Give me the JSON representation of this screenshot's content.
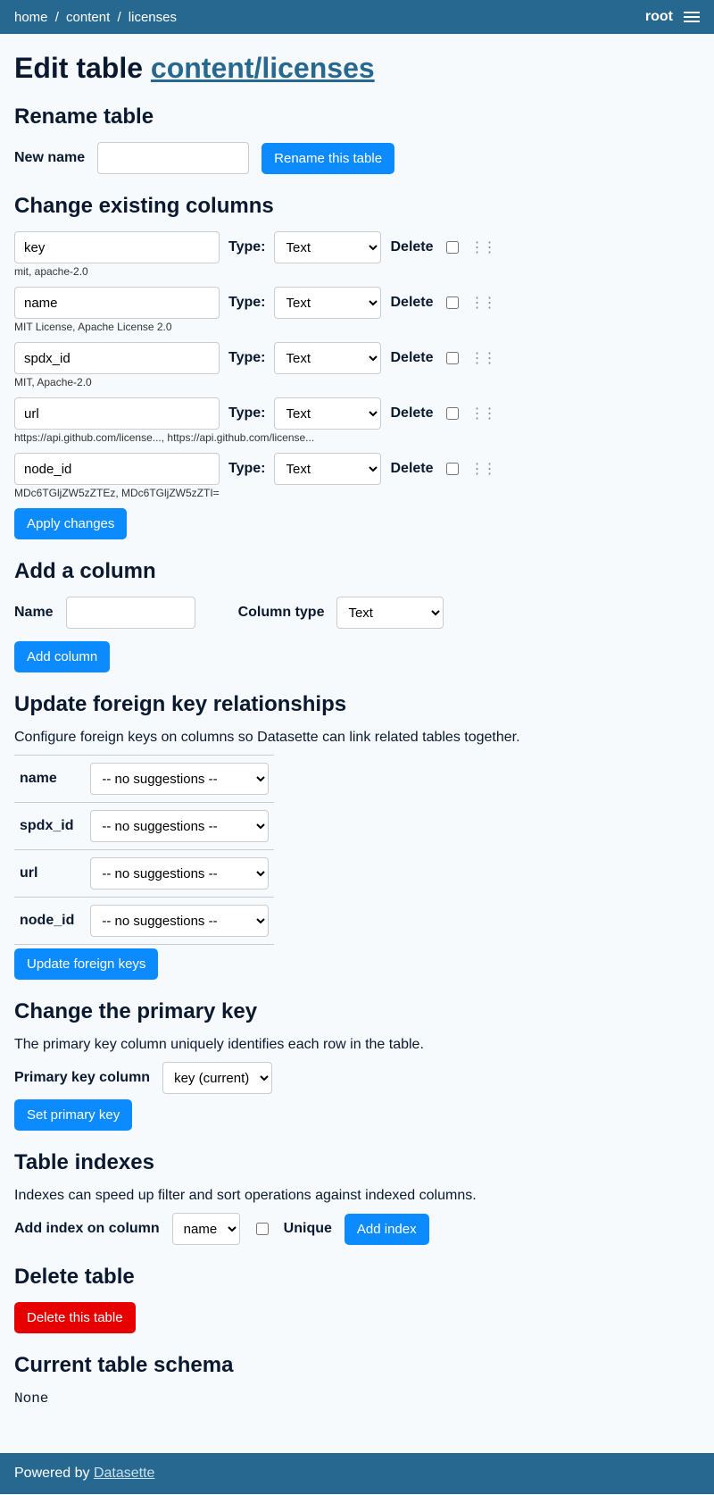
{
  "breadcrumb": {
    "home": "home",
    "content": "content",
    "licenses": "licenses"
  },
  "header": {
    "user": "root"
  },
  "page_title_prefix": "Edit table ",
  "page_title_link": "content/licenses",
  "rename": {
    "heading": "Rename table",
    "label": "New name",
    "button": "Rename this table"
  },
  "columns": {
    "heading": "Change existing columns",
    "type_label": "Type:",
    "delete_label": "Delete",
    "apply_button": "Apply changes",
    "type_options": [
      "Text"
    ],
    "items": [
      {
        "name": "key",
        "type": "Text",
        "sample": "mit, apache-2.0"
      },
      {
        "name": "name",
        "type": "Text",
        "sample": "MIT License, Apache License 2.0"
      },
      {
        "name": "spdx_id",
        "type": "Text",
        "sample": "MIT, Apache-2.0"
      },
      {
        "name": "url",
        "type": "Text",
        "sample": "https://api.github.com/license..., https://api.github.com/license..."
      },
      {
        "name": "node_id",
        "type": "Text",
        "sample": "MDc6TGljZW5zZTEz, MDc6TGljZW5zZTI="
      }
    ]
  },
  "add_column": {
    "heading": "Add a column",
    "name_label": "Name",
    "type_label": "Column type",
    "type_value": "Text",
    "button": "Add column"
  },
  "foreign_keys": {
    "heading": "Update foreign key relationships",
    "description": "Configure foreign keys on columns so Datasette can link related tables together.",
    "no_suggestions": "-- no suggestions --",
    "button": "Update foreign keys",
    "items": [
      {
        "col": "name"
      },
      {
        "col": "spdx_id"
      },
      {
        "col": "url"
      },
      {
        "col": "node_id"
      }
    ]
  },
  "primary_key": {
    "heading": "Change the primary key",
    "description": "The primary key column uniquely identifies each row in the table.",
    "label": "Primary key column",
    "value": "key (current)",
    "button": "Set primary key"
  },
  "indexes": {
    "heading": "Table indexes",
    "description": "Indexes can speed up filter and sort operations against indexed columns.",
    "label": "Add index on column",
    "value": "name",
    "unique_label": "Unique",
    "button": "Add index"
  },
  "delete": {
    "heading": "Delete table",
    "button": "Delete this table"
  },
  "schema": {
    "heading": "Current table schema",
    "value": "None"
  },
  "footer": {
    "prefix": "Powered by ",
    "link": "Datasette"
  }
}
